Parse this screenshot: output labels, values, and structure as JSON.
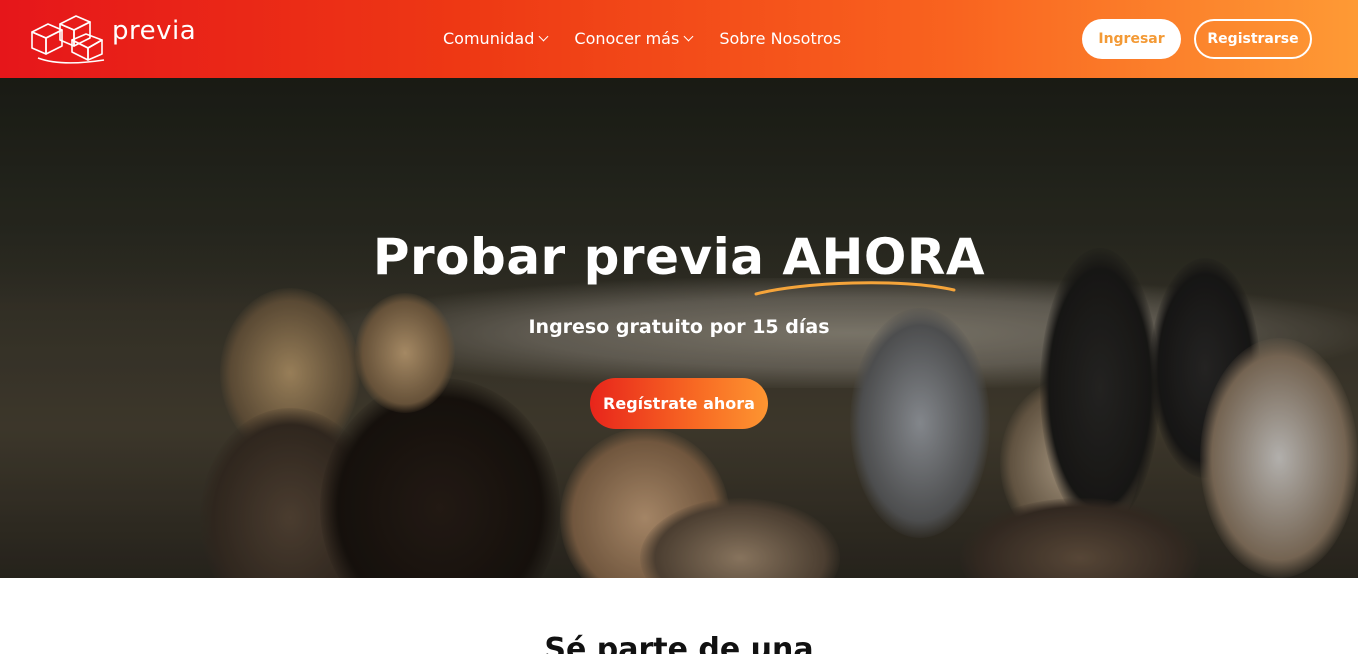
{
  "header": {
    "brand": "previa",
    "nav": [
      {
        "label": "Comunidad",
        "has_dropdown": true
      },
      {
        "label": "Conocer más",
        "has_dropdown": true
      },
      {
        "label": "Sobre Nosotros",
        "has_dropdown": false
      }
    ],
    "login_label": "Ingresar",
    "register_label": "Registrarse"
  },
  "hero": {
    "title": "Probar previa AHORA",
    "subtitle": "Ingreso gratuito por 15 días",
    "cta_label": "Regístrate ahora"
  },
  "section": {
    "title": "Sé parte de una"
  },
  "colors": {
    "gradient_start": "#e6161a",
    "gradient_end": "#fe9a35",
    "accent_orange": "#f39a36",
    "text_dark": "#111111"
  }
}
